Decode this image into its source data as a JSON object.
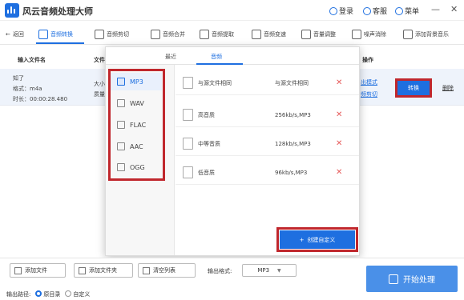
{
  "app": {
    "title": "风云音频处理大师"
  },
  "titlebar": {
    "login": "登录",
    "service": "客服",
    "menu": "菜单",
    "minimize": "—",
    "close": "✕"
  },
  "toolbar": {
    "back": "返回",
    "items": [
      {
        "label": "音频转换",
        "active": true
      },
      {
        "label": "音频剪切"
      },
      {
        "label": "音频合并"
      },
      {
        "label": "音频提取"
      },
      {
        "label": "音频变速"
      },
      {
        "label": "音量调整"
      },
      {
        "label": "噪声消除"
      },
      {
        "label": "添加背景音乐"
      }
    ]
  },
  "table": {
    "col_filename": "输入文件名",
    "col_file": "文件",
    "col_action": "操作",
    "row": {
      "name": "知了",
      "format": "格式：m4a",
      "duration": "时长：00:00:28.480",
      "size_prefix": "大小",
      "quality_prefix": "质量",
      "output_mode": "出模式",
      "trim": "频剪切",
      "convert": "转换",
      "delete": "删除"
    }
  },
  "popup": {
    "tabs": [
      "最近",
      "音频"
    ],
    "active_tab": "音频",
    "formats": [
      {
        "label": "MP3",
        "active": true
      },
      {
        "label": "WAV"
      },
      {
        "label": "FLAC"
      },
      {
        "label": "AAC"
      },
      {
        "label": "OGG"
      }
    ],
    "qualities": [
      {
        "name": "与源文件相同",
        "value": "与源文件相同"
      },
      {
        "name": "高音质",
        "value": "256kb/s,MP3"
      },
      {
        "name": "中等音质",
        "value": "128kb/s,MP3"
      },
      {
        "name": "低音质",
        "value": "96kb/s,MP3"
      }
    ],
    "remove_glyph": "✕",
    "custom_button": "创建自定义",
    "custom_plus": "+"
  },
  "bottom": {
    "add_file": "添加文件",
    "add_folder": "添加文件夹",
    "clear_list": "清空列表",
    "output_format_label": "输出格式:",
    "output_format_value": "MP3",
    "start": "开始处理",
    "output_path_label": "输出路径:",
    "path_options": [
      "原目录",
      "自定义"
    ],
    "path_selected": "原目录"
  },
  "colors": {
    "accent": "#1e6fe0",
    "highlight": "#c0272d"
  }
}
